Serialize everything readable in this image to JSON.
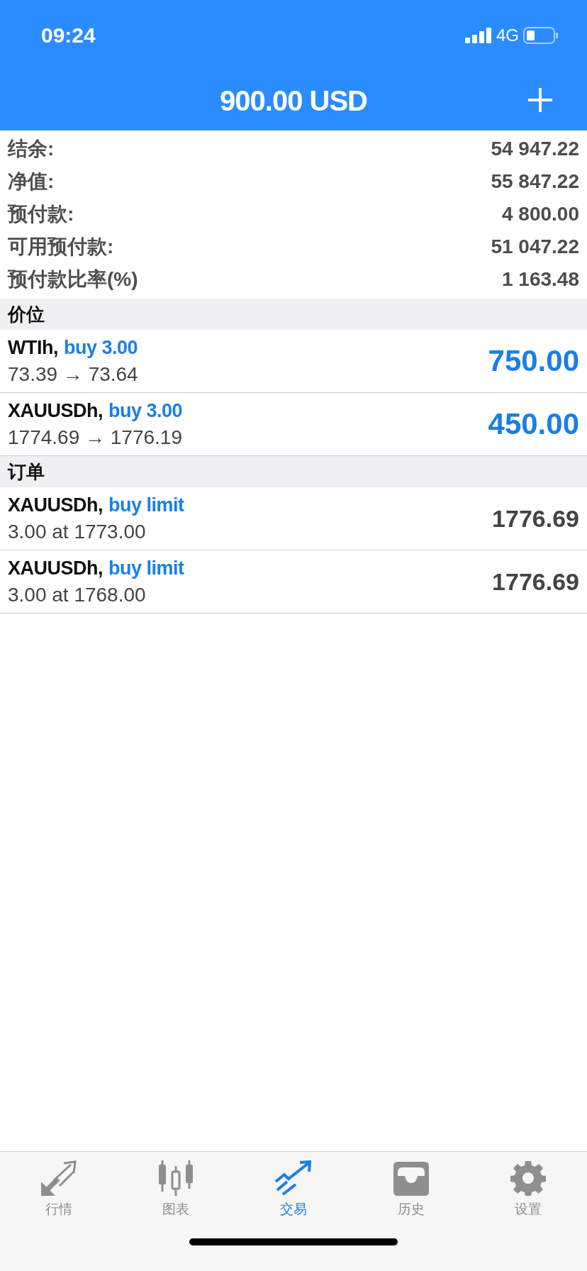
{
  "status_bar": {
    "time": "09:24",
    "network": "4G"
  },
  "header": {
    "title": "900.00 USD"
  },
  "summary": [
    {
      "label": "结余:",
      "value": "54 947.22"
    },
    {
      "label": "净值:",
      "value": "55 847.22"
    },
    {
      "label": "预付款:",
      "value": "4 800.00"
    },
    {
      "label": "可用预付款:",
      "value": "51 047.22"
    },
    {
      "label": "预付款比率(%)",
      "value": "1 163.48"
    }
  ],
  "sections": [
    {
      "title": "价位",
      "kind": "positions",
      "items": [
        {
          "symbol": "WTIh,",
          "action": "buy 3.00",
          "detail": "73.39 → 73.64",
          "value": "750.00"
        },
        {
          "symbol": "XAUUSDh,",
          "action": "buy 3.00",
          "detail": "1774.69 → 1776.19",
          "value": "450.00"
        }
      ]
    },
    {
      "title": "订单",
      "kind": "orders",
      "items": [
        {
          "symbol": "XAUUSDh,",
          "action": "buy limit",
          "detail": "3.00 at 1773.00",
          "value": "1776.69"
        },
        {
          "symbol": "XAUUSDh,",
          "action": "buy limit",
          "detail": "3.00 at 1768.00",
          "value": "1776.69"
        }
      ]
    }
  ],
  "tab_bar": [
    {
      "label": "行情",
      "selected": false
    },
    {
      "label": "图表",
      "selected": false
    },
    {
      "label": "交易",
      "selected": true
    },
    {
      "label": "历史",
      "selected": false
    },
    {
      "label": "设置",
      "selected": false
    }
  ]
}
